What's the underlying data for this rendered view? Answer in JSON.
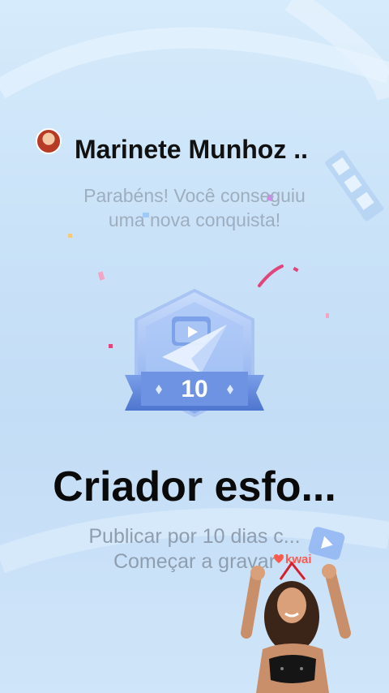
{
  "user": {
    "name": "Marinete Munhoz .."
  },
  "congrats": {
    "line1": "Parabéns! Você conseguiu",
    "line2": "uma nova conquista!"
  },
  "badge": {
    "number": "10"
  },
  "achievement": {
    "title": "Criador esfo...",
    "desc_line1": "Publicar por 10 dias c...",
    "desc_line2": "Começar a gravar"
  },
  "watermark": {
    "brand": "kwai"
  },
  "colors": {
    "background": "#cfe5f9",
    "badge_main": "#8fb1ef",
    "badge_ribbon": "#5f86d9",
    "text_dark": "#111111",
    "text_muted": "#9eaebf",
    "confetti_pink": "#e0457b"
  }
}
